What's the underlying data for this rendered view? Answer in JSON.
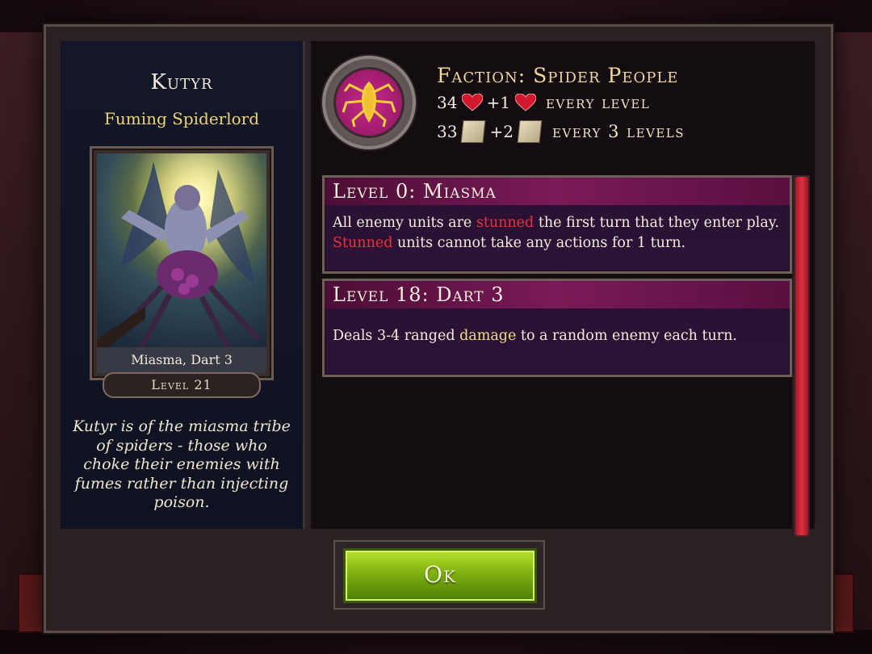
{
  "hero": {
    "name": "Kutyr",
    "title": "Fuming Spiderlord",
    "card_caption": "Miasma, Dart 3",
    "level_label": "Level 21",
    "lore": "Kutyr is of the miasma tribe of spiders - those who choke their enemies with fumes rather than injecting poison."
  },
  "faction": {
    "label": "Faction: Spider People",
    "icon": "spider-icon",
    "emblem_color": "#b8207a"
  },
  "stats": {
    "health": {
      "base": "34",
      "gain": "+1",
      "every": "every level",
      "icon": "heart-icon"
    },
    "power": {
      "base": "33",
      "gain": "+2",
      "every": "every 3 levels",
      "icon": "scroll-icon"
    }
  },
  "abilities": [
    {
      "header": "Level 0: Miasma",
      "parts": [
        {
          "text": "All enemy units are ",
          "style": "plain"
        },
        {
          "text": "stunned",
          "style": "red"
        },
        {
          "text": " the first turn that they enter play.",
          "style": "plain"
        },
        {
          "text": "Stunned",
          "style": "red"
        },
        {
          "text": " units cannot take any actions for 1 turn.",
          "style": "plain"
        }
      ]
    },
    {
      "header": "Level 18: Dart 3",
      "parts": [
        {
          "text": "Deals 3-4 ranged ",
          "style": "plain"
        },
        {
          "text": "damage",
          "style": "yellow"
        },
        {
          "text": " to a random enemy each turn.",
          "style": "plain"
        }
      ]
    }
  ],
  "ok_button": "Ok",
  "colors": {
    "accent_red": "#e8333a",
    "accent_gold": "#f0d79a",
    "button_green": "#7fb112"
  }
}
